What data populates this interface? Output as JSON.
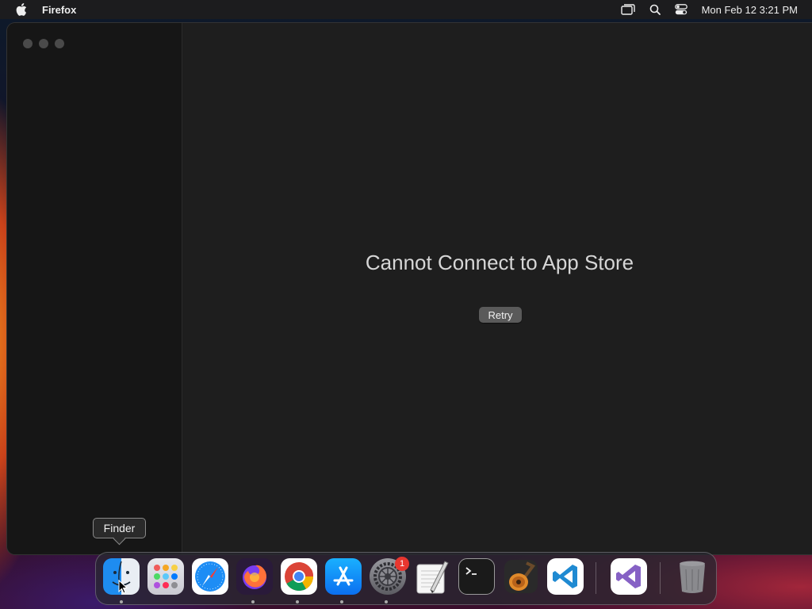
{
  "menubar": {
    "app_name": "Firefox",
    "clock": "Mon Feb 12  3:21 PM",
    "icons": [
      "apple-icon",
      "screen-mirroring-icon",
      "search-icon",
      "control-center-icon"
    ]
  },
  "window": {
    "error_title": "Cannot Connect to App Store",
    "retry_label": "Retry"
  },
  "tooltip": {
    "text": "Finder"
  },
  "dock": {
    "items": [
      {
        "name": "finder",
        "running": true
      },
      {
        "name": "launchpad",
        "running": false
      },
      {
        "name": "safari",
        "running": false
      },
      {
        "name": "firefox",
        "running": true
      },
      {
        "name": "chrome",
        "running": true
      },
      {
        "name": "app-store",
        "running": true
      },
      {
        "name": "system-settings",
        "running": true,
        "badge": "1"
      },
      {
        "name": "textedit",
        "running": false
      },
      {
        "name": "terminal",
        "running": false
      },
      {
        "name": "garageband",
        "running": false
      },
      {
        "name": "vscode",
        "running": false
      },
      {
        "name": "visual-studio",
        "running": false
      },
      {
        "name": "trash",
        "running": false
      }
    ]
  }
}
